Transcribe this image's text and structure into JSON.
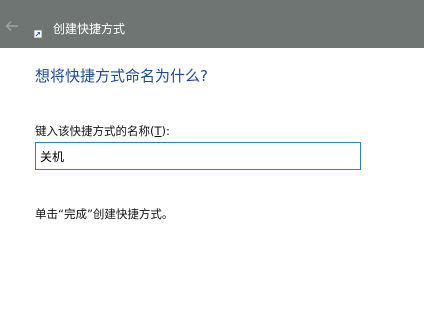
{
  "window": {
    "title": "创建快捷方式",
    "back_icon": "back-arrow-icon",
    "app_icon": "shortcut-icon"
  },
  "wizard": {
    "heading": "想将快捷方式命名为什么?",
    "name_label_prefix": "键入该快捷方式的名称(",
    "name_label_access_key": "T",
    "name_label_suffix": "):",
    "name_value": "关机",
    "hint": "单击“完成”创建快捷方式。"
  },
  "colors": {
    "titlebar": "#6f7573",
    "heading": "#1e4a94",
    "input_border": "#2d7bd6"
  }
}
